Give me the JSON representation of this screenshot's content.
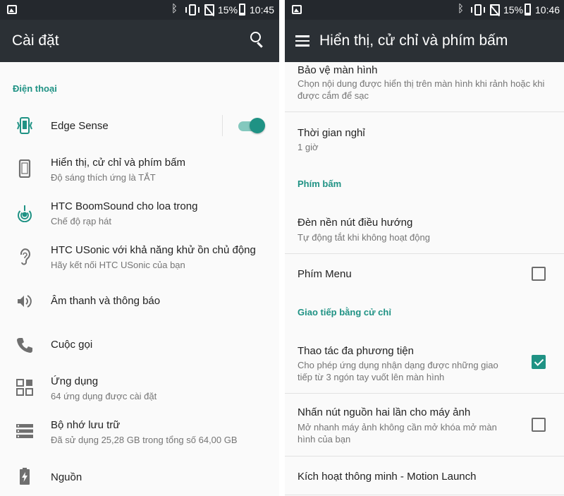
{
  "colors": {
    "accent": "#1f9284",
    "appbar": "#2b3035",
    "statusbar": "#24282d",
    "icon_gray": "#6f6f6f"
  },
  "left": {
    "status": {
      "battery": "15%",
      "time": "10:45"
    },
    "title": "Cài đặt",
    "section": "Điện thoại",
    "items": [
      {
        "icon": "edge-sense-icon",
        "title": "Edge Sense",
        "subtitle": "",
        "toggle_on": true
      },
      {
        "icon": "phone-display-icon",
        "title": "Hiển thị, cử chỉ và phím bấm",
        "subtitle": "Độ sáng thích ứng là TẮT"
      },
      {
        "icon": "boomsound-icon",
        "title": "HTC BoomSound cho loa trong",
        "subtitle": "Chế độ rạp hát"
      },
      {
        "icon": "ear-icon",
        "title": "HTC USonic với khả năng khử ồn chủ động",
        "subtitle": "Hãy kết nối HTC USonic của bạn"
      },
      {
        "icon": "speaker-icon",
        "title": "Âm thanh và thông báo",
        "subtitle": ""
      },
      {
        "icon": "phone-call-icon",
        "title": "Cuộc gọi",
        "subtitle": ""
      },
      {
        "icon": "apps-grid-icon",
        "title": "Ứng dụng",
        "subtitle": "64 ứng dụng được cài đặt"
      },
      {
        "icon": "storage-icon",
        "title": "Bộ nhớ lưu trữ",
        "subtitle": "Đã sử dụng 25,28 GB trong tổng số 64,00 GB"
      },
      {
        "icon": "battery-charging-icon",
        "title": "Nguồn",
        "subtitle": ""
      }
    ]
  },
  "right": {
    "status": {
      "battery": "15%",
      "time": "10:46"
    },
    "title": "Hiển thị, cử chỉ và phím bấm",
    "items": [
      {
        "title": "Bảo vệ màn hình",
        "subtitle": "Chọn nội dung được hiển thị trên màn hình khi rảnh hoặc khi được cắm để sạc"
      },
      {
        "title": "Thời gian nghỉ",
        "subtitle": "1 giờ"
      },
      {
        "title": "Đèn nền nút điều hướng",
        "subtitle": "Tự động tắt khi không hoạt động"
      },
      {
        "title": "Phím Menu",
        "subtitle": "",
        "checked": false
      },
      {
        "title": "Thao tác đa phương tiện",
        "subtitle": "Cho phép ứng dụng nhận dạng được những giao tiếp từ 3 ngón tay vuốt lên màn hình",
        "checked": true
      },
      {
        "title": "Nhấn nút nguồn hai lần cho máy ảnh",
        "subtitle": "Mở nhanh máy ảnh không cần mở khóa mở màn hình của bạn",
        "checked": false
      },
      {
        "title": "Kích hoạt thông minh - Motion Launch",
        "subtitle": ""
      }
    ],
    "sections": [
      "Phím bấm",
      "Giao tiếp bằng cử chỉ"
    ]
  }
}
